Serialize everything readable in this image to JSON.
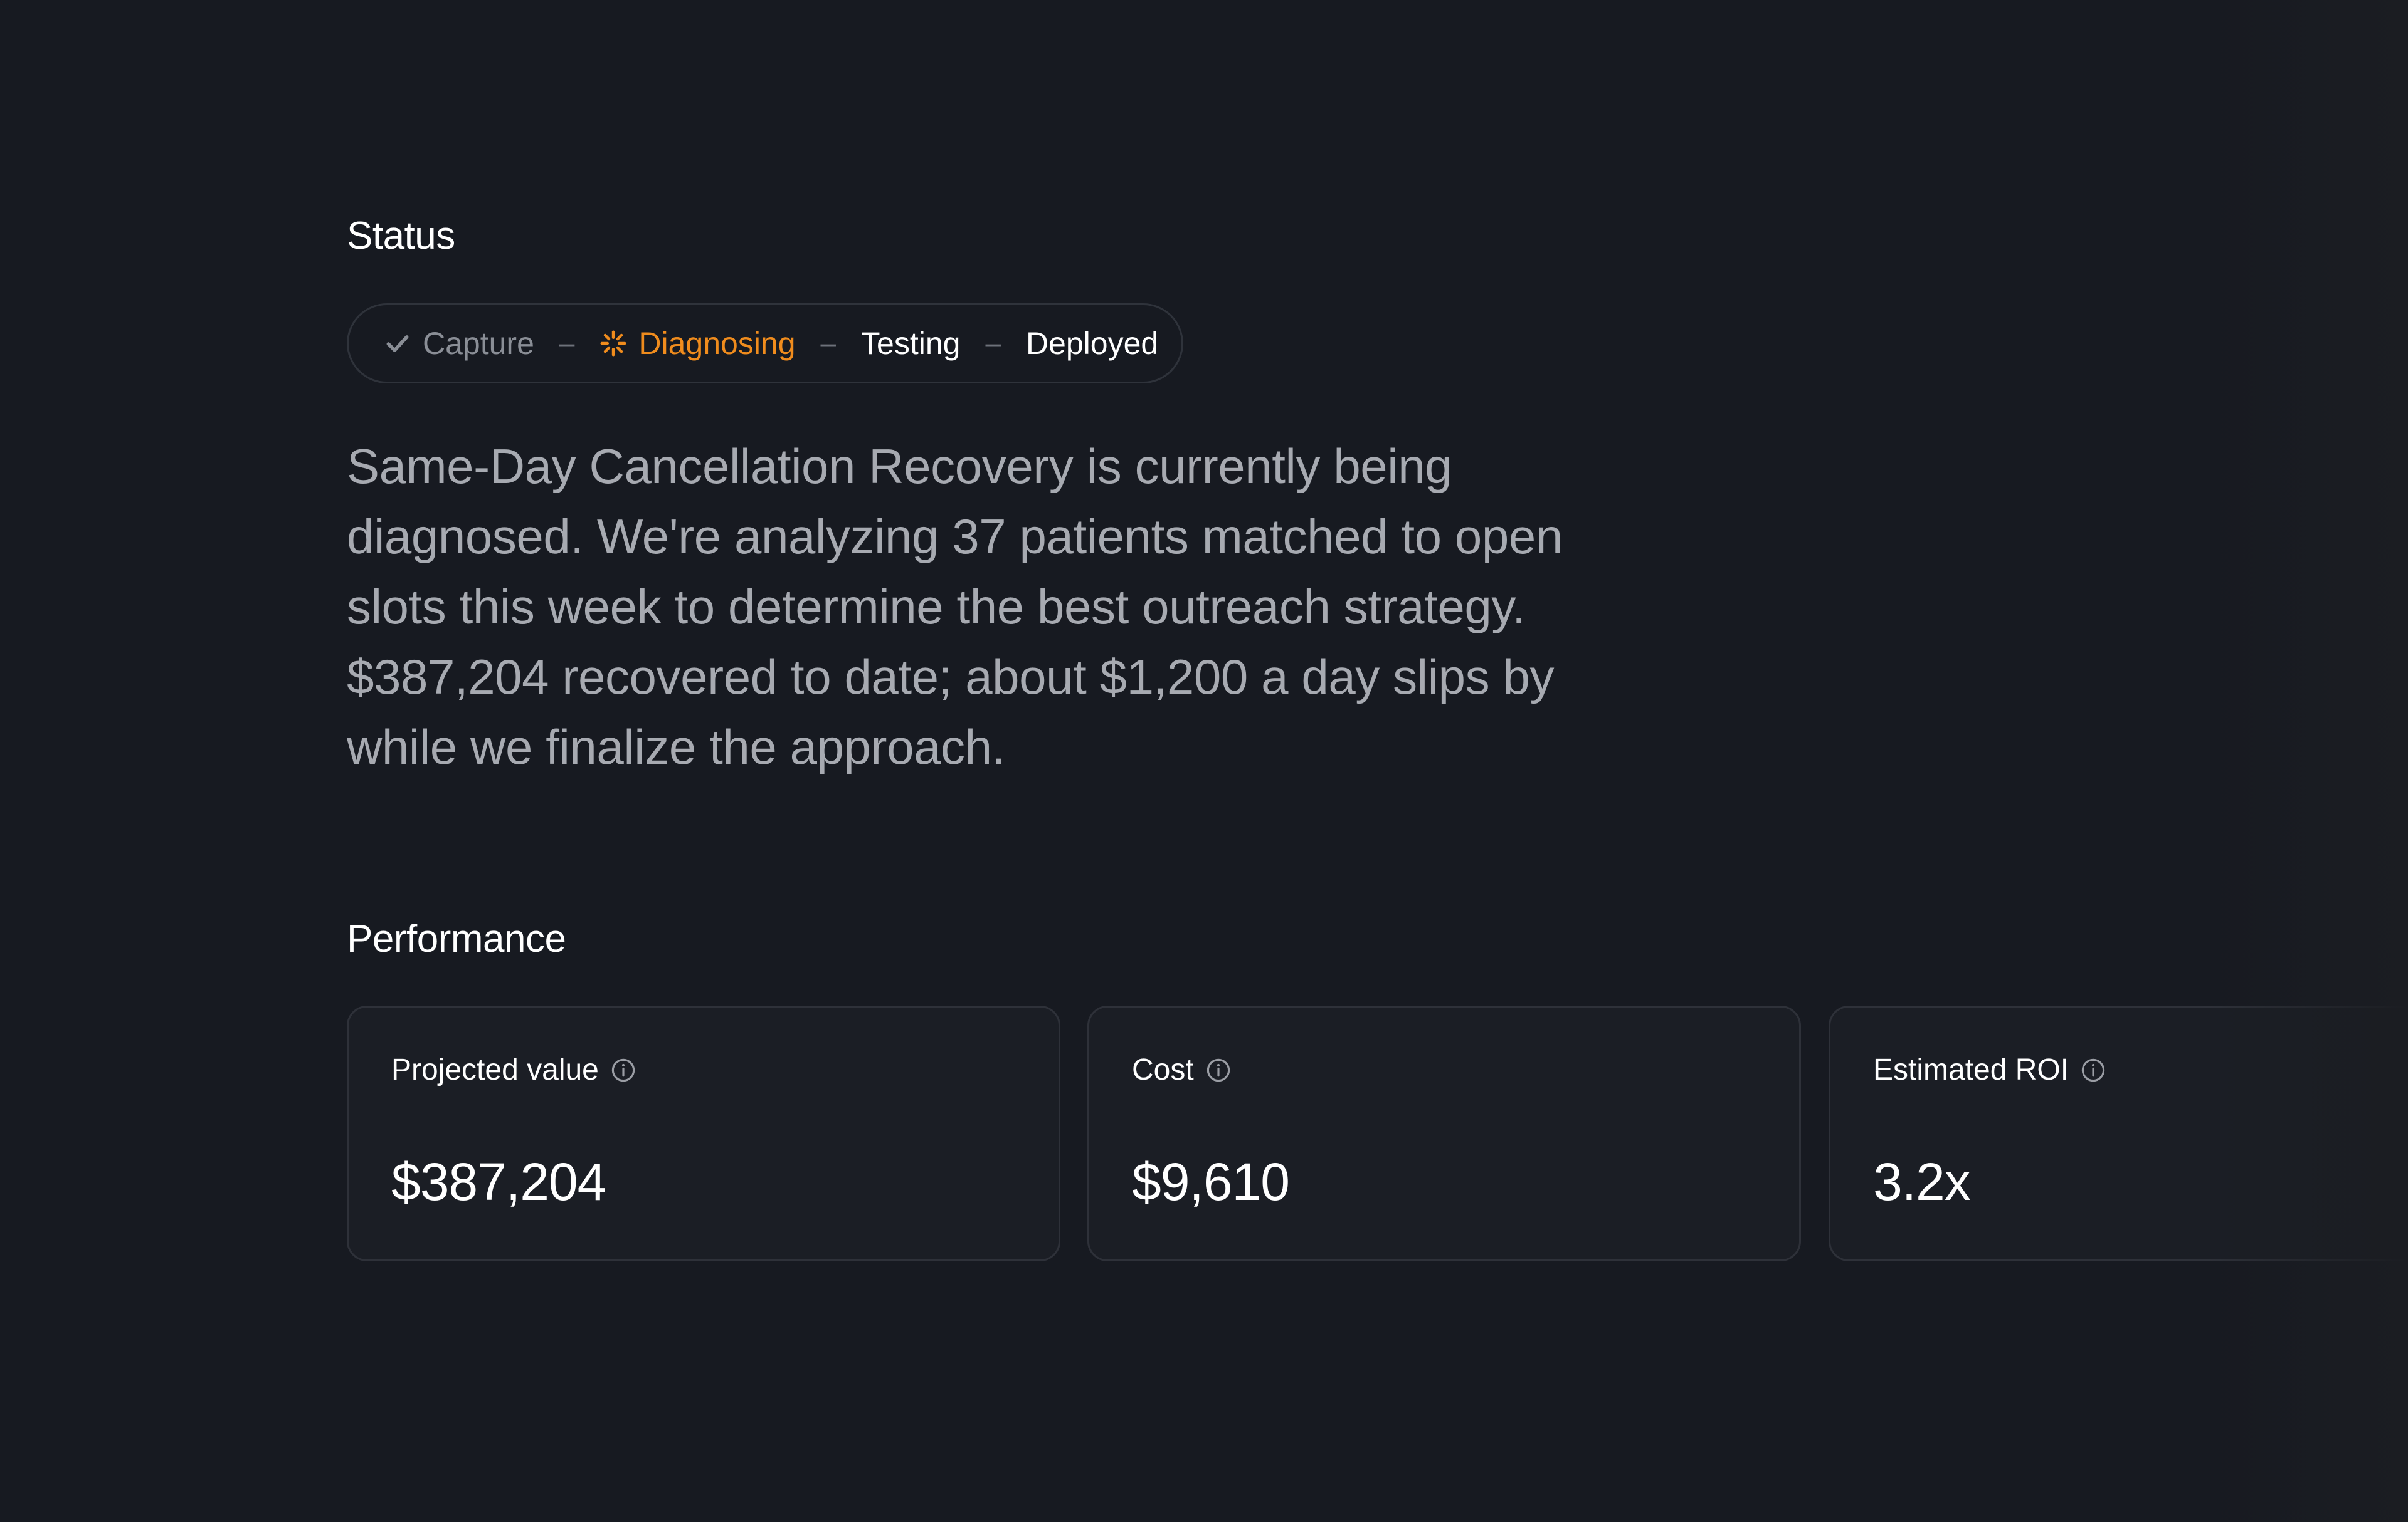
{
  "status": {
    "title": "Status",
    "steps": [
      {
        "label": "Capture",
        "state": "done",
        "icon": "check-icon"
      },
      {
        "label": "Diagnosing",
        "state": "active",
        "icon": "spinner-icon"
      },
      {
        "label": "Testing",
        "state": "pending"
      },
      {
        "label": "Deployed",
        "state": "pending"
      }
    ],
    "separator": "–",
    "description": "Same-Day Cancellation Recovery is currently being diagnosed. We're analyzing 37 patients matched to open slots this week to determine the best outreach strategy. $387,204 recovered to date; about $1,200 a day slips by while we finalize the approach."
  },
  "performance": {
    "title": "Performance",
    "cards": [
      {
        "label": "Projected value",
        "value": "$387,204",
        "icon": "info-icon"
      },
      {
        "label": "Cost",
        "value": "$9,610",
        "icon": "info-icon"
      },
      {
        "label": "Estimated ROI",
        "value": "3.2x",
        "icon": "info-icon"
      }
    ]
  },
  "colors": {
    "background": "#171a21",
    "card_background": "#1b1e25",
    "border": "#2e3139",
    "accent_active": "#f08c1d",
    "muted_text": "#a7aab1",
    "done_text": "#8a8e96"
  }
}
